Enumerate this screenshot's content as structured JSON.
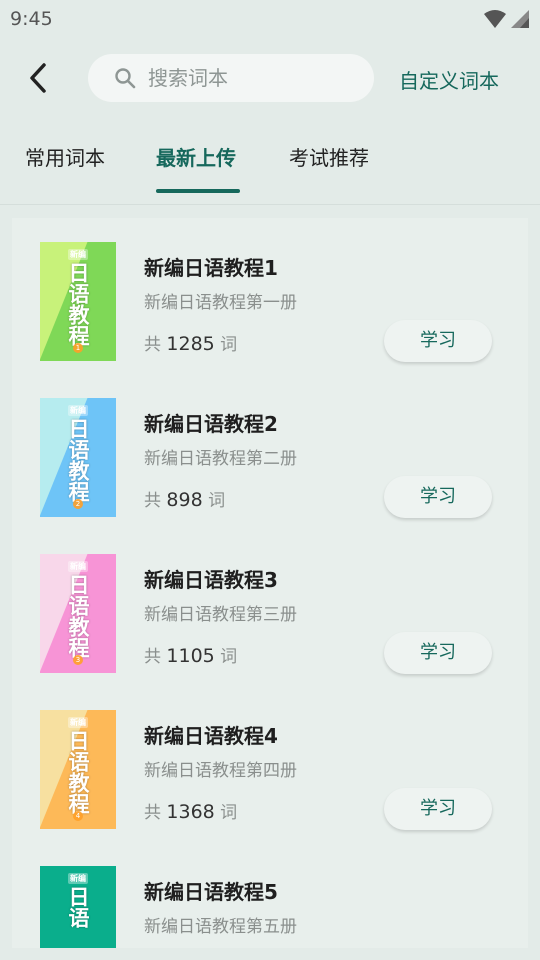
{
  "status": {
    "time": "9:45"
  },
  "header": {
    "search_placeholder": "搜索词本",
    "custom_link": "自定义词本"
  },
  "tabs": [
    {
      "label": "常用词本",
      "active": false
    },
    {
      "label": "最新上传",
      "active": true
    },
    {
      "label": "考试推荐",
      "active": false
    }
  ],
  "books": [
    {
      "title": "新编日语教程1",
      "subtitle": "新编日语教程第一册",
      "count_prefix": "共",
      "count": "1285",
      "count_suffix": "词",
      "button": "学习",
      "cover_color": "#7fd857",
      "cover_accent": "#c8f27a",
      "cover_text": "日语教程",
      "cover_tag": "新编",
      "cover_num": "1"
    },
    {
      "title": "新编日语教程2",
      "subtitle": "新编日语教程第二册",
      "count_prefix": "共",
      "count": "898",
      "count_suffix": "词",
      "button": "学习",
      "cover_color": "#6ec4f7",
      "cover_accent": "#b6ecef",
      "cover_text": "日语教程",
      "cover_tag": "新编",
      "cover_num": "2"
    },
    {
      "title": "新编日语教程3",
      "subtitle": "新编日语教程第三册",
      "count_prefix": "共",
      "count": "1105",
      "count_suffix": "词",
      "button": "学习",
      "cover_color": "#f794d6",
      "cover_accent": "#f8d7ea",
      "cover_text": "日语教程",
      "cover_tag": "新编",
      "cover_num": "3"
    },
    {
      "title": "新编日语教程4",
      "subtitle": "新编日语教程第四册",
      "count_prefix": "共",
      "count": "1368",
      "count_suffix": "词",
      "button": "学习",
      "cover_color": "#fdb958",
      "cover_accent": "#f7e0a0",
      "cover_text": "日语教程",
      "cover_tag": "新编",
      "cover_num": "4"
    },
    {
      "title": "新编日语教程5",
      "subtitle": "新编日语教程第五册",
      "count_prefix": "",
      "count": "",
      "count_suffix": "",
      "button": "",
      "cover_color": "#0aae8c",
      "cover_accent": "#0aae8c",
      "cover_text": "日语",
      "cover_tag": "新编",
      "cover_num": ""
    }
  ],
  "colors": {
    "accent": "#16685c",
    "background": "#e3ebe8"
  },
  "icons": {
    "back": "arrow-left-icon",
    "search": "search-icon",
    "wifi": "wifi-icon",
    "signal": "signal-icon"
  }
}
